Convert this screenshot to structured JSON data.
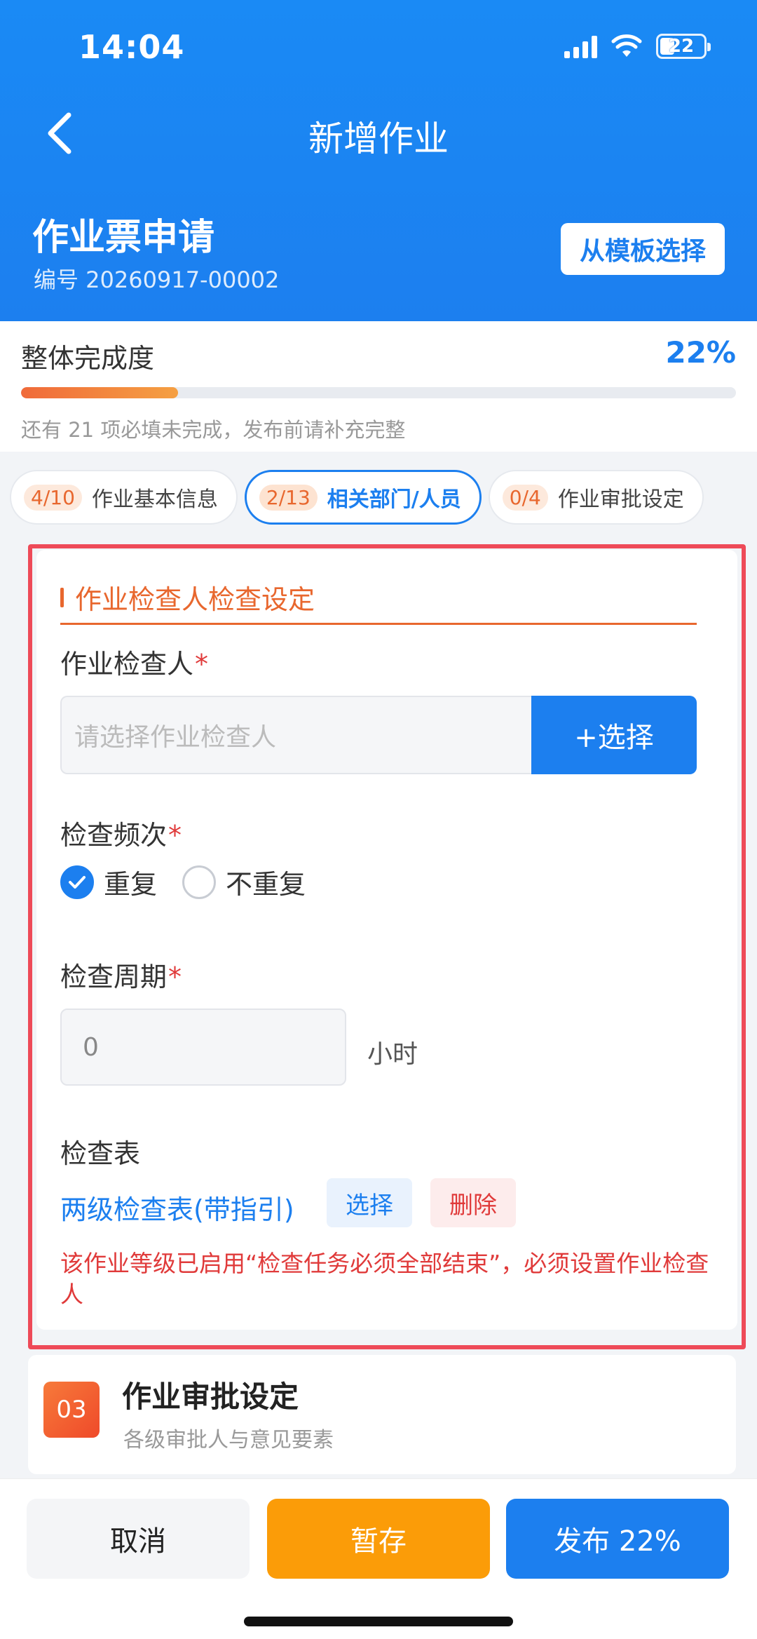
{
  "status_bar": {
    "time": "14:04",
    "battery": "22"
  },
  "nav": {
    "title": "新增作业"
  },
  "form": {
    "title": "作业票申请",
    "number": "编号 20260917-00002",
    "template_button": "从模板选择"
  },
  "progress": {
    "label": "整体完成度",
    "percent_text": "22%",
    "percent": 22,
    "hint": "还有 21 项必填未完成，发布前请补充完整"
  },
  "tabs": [
    {
      "count": "4/10",
      "label": "作业基本信息",
      "active": false
    },
    {
      "count": "2/13",
      "label": "相关部门/人员",
      "active": true
    },
    {
      "count": "0/4",
      "label": "作业审批设定",
      "active": false
    }
  ],
  "inspector_section": {
    "title": "作业检查人检查设定",
    "inspector": {
      "label": "作业检查人",
      "required_mark": "*",
      "placeholder": "请选择作业检查人",
      "select_button": "+选择"
    },
    "frequency": {
      "label": "检查频次",
      "required_mark": "*",
      "options": [
        {
          "label": "重复",
          "checked": true
        },
        {
          "label": "不重复",
          "checked": false
        }
      ]
    },
    "period": {
      "label": "检查周期",
      "required_mark": "*",
      "value": "0",
      "unit": "小时"
    },
    "checklist": {
      "label": "检查表",
      "name": "两级检查表(带指引)",
      "choose_button": "选择",
      "delete_button": "删除",
      "warning": "该作业等级已启用“检查任务必须全部结束”，必须设置作业检查人"
    }
  },
  "next_section": {
    "step": "03",
    "title": "作业审批设定",
    "subtitle": "各级审批人与意见要素"
  },
  "bottom_bar": {
    "cancel": "取消",
    "save": "暂存",
    "publish": "发布 22%"
  },
  "colors": {
    "primary": "#1c7fef",
    "accent": "#e8672e",
    "danger": "#e03a3a",
    "save": "#fb9c08",
    "highlight_border": "#ee4a58"
  }
}
